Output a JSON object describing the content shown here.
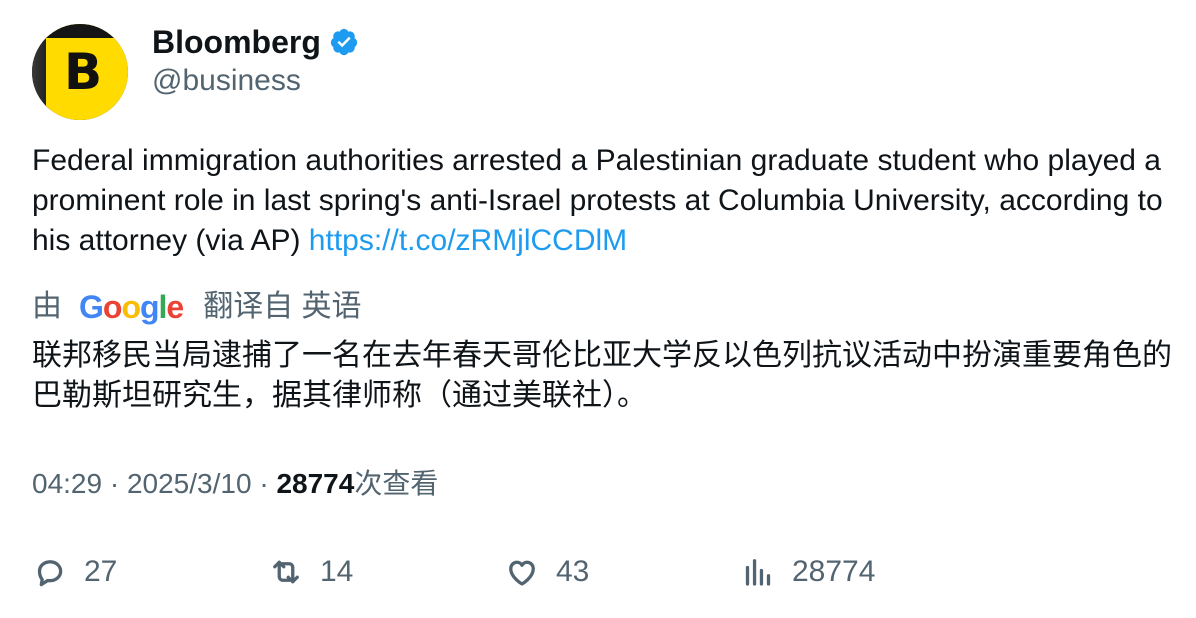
{
  "author": {
    "display_name": "Bloomberg",
    "handle": "@business",
    "avatar_letter": "B",
    "avatar_color": "#ffdb00",
    "verified": true,
    "verified_color": "#1d9bf0"
  },
  "tweet": {
    "text": "Federal immigration authorities arrested a Palestinian graduate student who played a prominent role in last spring's anti-Israel protests at Columbia University, according to his attorney (via AP) ",
    "link": "https://t.co/zRMjlCCDlM",
    "link_color": "#1d9bf0"
  },
  "translation": {
    "prefix": "由",
    "provider_letters": [
      "G",
      "o",
      "o",
      "g",
      "l",
      "e"
    ],
    "suffix": "翻译自 英语",
    "text": "联邦移民当局逮捕了一名在去年春天哥伦比亚大学反以色列抗议活动中扮演重要角色的巴勒斯坦研究生，据其律师称（通过美联社）。"
  },
  "meta": {
    "time": "04:29",
    "separator": " · ",
    "date": "2025/3/10",
    "views_count": "28774",
    "views_label": "次查看"
  },
  "actions": {
    "replies": {
      "icon": "reply-icon",
      "count": "27"
    },
    "retweets": {
      "icon": "retweet-icon",
      "count": "14"
    },
    "likes": {
      "icon": "heart-icon",
      "count": "43"
    },
    "views": {
      "icon": "analytics-icon",
      "count": "28774"
    }
  }
}
